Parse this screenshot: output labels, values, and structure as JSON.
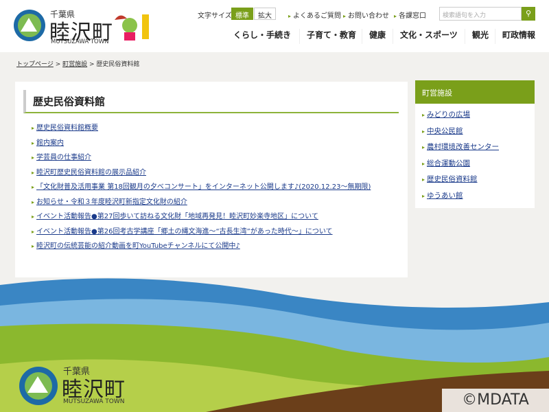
{
  "header": {
    "pref": "千葉県",
    "town": "睦沢町",
    "town_en": "MUTSUZAWA TOWN",
    "font_size_label": "文字サイズ",
    "font_standard": "標準",
    "font_large": "拡大",
    "links": [
      "よくあるご質問",
      "お問い合わせ",
      "各課窓口"
    ],
    "search_placeholder": "検索語句を入力",
    "nav": [
      "くらし・手続き",
      "子育て・教育",
      "健康",
      "文化・スポーツ",
      "観光",
      "町政情報"
    ]
  },
  "breadcrumb": {
    "home": "トップページ",
    "parent": "町営施設",
    "current": "歴史民俗資料館"
  },
  "main": {
    "title": "歴史民俗資料館",
    "items": [
      "歴史民俗資料館概要",
      "館内案内",
      "学芸員の仕事紹介",
      "睦沢町歴史民俗資料館の展示品紹介",
      "「文化財普及活用事業 第18回観月の夕べコンサート」をインターネット公開します♪(2020.12.23～無期限)",
      "お知らせ・令和３年度睦沢町新指定文化財の紹介",
      "イベント活動報告●第27回歩いて訪ねる文化財「地域再発見！睦沢町妙楽寺地区」について",
      "イベント活動報告●第26回考古学講座「郷土の縄文海進～“古長生湾”があった時代～」について",
      "睦沢町の伝統芸能の紹介動画を町YouTubeチャンネルにて公開中♪"
    ]
  },
  "sidebar": {
    "title": "町営施設",
    "items": [
      "みどりの広場",
      "中央公民館",
      "農村環境改善センター",
      "総合運動公園",
      "歴史民俗資料館",
      "ゆうあい館"
    ]
  },
  "footer": {
    "pref": "千葉県",
    "town": "睦沢町",
    "town_en": "MUTSUZAWA TOWN"
  },
  "watermark": "©MDATA"
}
